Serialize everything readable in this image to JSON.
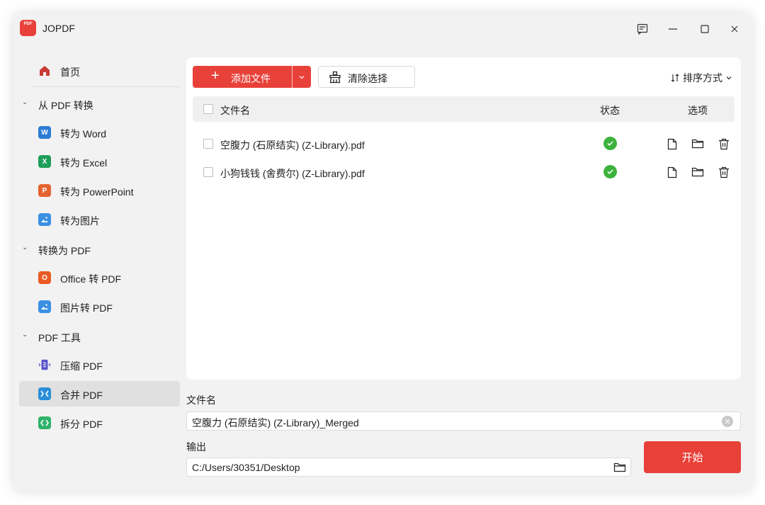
{
  "app": {
    "logo_text": "PDF",
    "title": "JOPDF"
  },
  "window_controls": [
    "feedback-icon",
    "minimize-icon",
    "maximize-icon",
    "close-icon"
  ],
  "sidebar": {
    "home": {
      "label": "首页",
      "icon": "home-icon"
    },
    "groups": [
      {
        "label": "从 PDF 转换",
        "items": [
          {
            "label": "转为 Word",
            "icon": "word-icon",
            "icon_text": "W",
            "color": "#2b7cd3"
          },
          {
            "label": "转为 Excel",
            "icon": "excel-icon",
            "icon_text": "X",
            "color": "#1e9e5a"
          },
          {
            "label": "转为 PowerPoint",
            "icon": "powerpoint-icon",
            "icon_text": "P",
            "color": "#e5622e"
          },
          {
            "label": "转为图片",
            "icon": "image-icon",
            "icon_text": "",
            "color": "#3b8fe3"
          }
        ]
      },
      {
        "label": "转换为 PDF",
        "items": [
          {
            "label": "Office 转 PDF",
            "icon": "office-icon",
            "icon_text": "O",
            "color": "#eb5a24"
          },
          {
            "label": "图片转 PDF",
            "icon": "image-icon",
            "icon_text": "",
            "color": "#3b8fe3"
          }
        ]
      },
      {
        "label": "PDF 工具",
        "items": [
          {
            "label": "压缩 PDF",
            "icon": "compress-icon",
            "icon_text": "",
            "color": "#5a54c9"
          },
          {
            "label": "合并 PDF",
            "icon": "merge-icon",
            "icon_text": "",
            "color": "#2a8fd8",
            "active": true
          },
          {
            "label": "拆分 PDF",
            "icon": "split-icon",
            "icon_text": "",
            "color": "#2eb36a"
          }
        ]
      }
    ]
  },
  "toolbar": {
    "add_label": "添加文件",
    "clear_label": "清除选择",
    "sort_label": "排序方式"
  },
  "table": {
    "headers": {
      "name": "文件名",
      "status": "状态",
      "options": "选项"
    },
    "rows": [
      {
        "name": "空腹力 (石原结实) (Z-Library).pdf",
        "status": "success"
      },
      {
        "name": "小狗钱钱 (舍费尔) (Z-Library).pdf",
        "status": "success"
      }
    ]
  },
  "form": {
    "filename_label": "文件名",
    "filename_value": "空腹力 (石原结实) (Z-Library)_Merged",
    "output_label": "输出",
    "output_value": "C:/Users/30351/Desktop"
  },
  "start_label": "开始",
  "colors": {
    "accent": "#e8413a",
    "success": "#3db33d"
  }
}
